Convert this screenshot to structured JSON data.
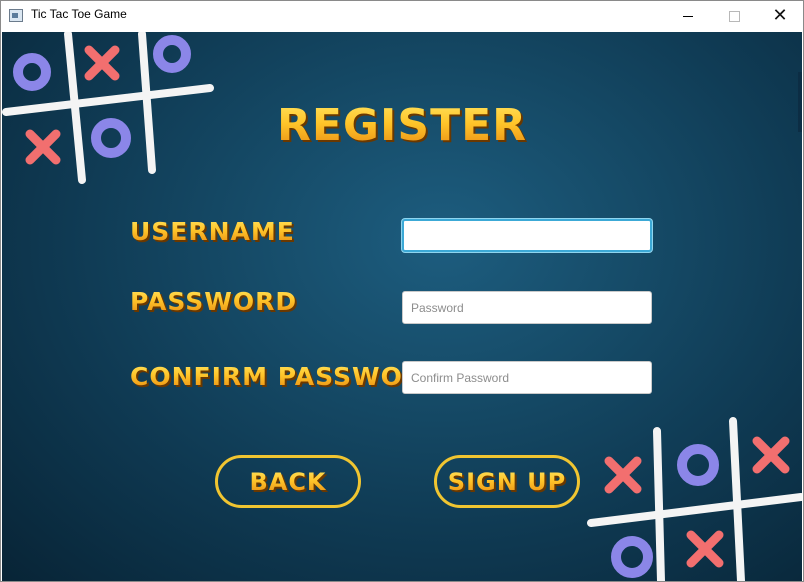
{
  "window": {
    "title": "Tic Tac Toe Game"
  },
  "controls": {
    "minimize": "minimize-icon",
    "maximize": "maximize-icon",
    "close": "close-icon"
  },
  "page": {
    "heading": "REGISTER"
  },
  "form": {
    "username": {
      "label": "USERNAME",
      "value": "",
      "placeholder": ""
    },
    "password": {
      "label": "PASSWORD",
      "value": "",
      "placeholder": "Password"
    },
    "confirm_password": {
      "label": "CONFIRM PASSWORD",
      "value": "",
      "placeholder": "Confirm Password"
    }
  },
  "buttons": {
    "back": "BACK",
    "sign_up": "SIGN UP"
  },
  "colors": {
    "background": "#164c69",
    "title_gradient_top": "#ffe460",
    "title_gradient_bottom": "#e78a12",
    "button_border": "#f0c531",
    "x_mark": "#f26f6f",
    "o_mark": "#8b86e8"
  }
}
